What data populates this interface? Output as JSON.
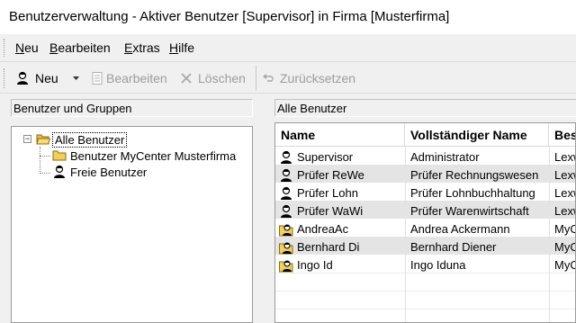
{
  "window": {
    "title": "Benutzerverwaltung - Aktiver Benutzer [Supervisor] in Firma [Musterfirma]"
  },
  "menu": {
    "items": [
      {
        "key": "N",
        "rest": "eu"
      },
      {
        "key": "B",
        "rest": "earbeiten"
      },
      {
        "key": "E",
        "rest": "xtras"
      },
      {
        "key": "H",
        "rest": "ilfe"
      }
    ]
  },
  "toolbar": {
    "new_label": "Neu",
    "edit_label": "Bearbeiten",
    "delete_label": "Löschen",
    "reset_label": "Zurücksetzen",
    "disabled_color": "#9c9c9c"
  },
  "left_panel": {
    "header": "Benutzer und Gruppen",
    "tree": {
      "root": {
        "label": "Alle Benutzer",
        "expander": "−",
        "icon": "folder-open-icon"
      },
      "children": [
        {
          "label": "Benutzer MyCenter Musterfirma",
          "icon": "folder-icon"
        },
        {
          "label": "Freie Benutzer",
          "icon": "user-icon"
        }
      ]
    }
  },
  "right_panel": {
    "header": "Alle Benutzer",
    "columns": [
      "Name",
      "Vollständiger Name",
      "Bes"
    ],
    "rows": [
      {
        "name": "Supervisor",
        "full": "Administrator",
        "desc": "Lexw",
        "icon": "user-dark-icon"
      },
      {
        "name": "Prüfer ReWe",
        "full": "Prüfer Rechnungswesen",
        "desc": "Lexw",
        "icon": "user-dark-icon"
      },
      {
        "name": "Prüfer Lohn",
        "full": "Prüfer Lohnbuchhaltung",
        "desc": "Lexw",
        "icon": "user-dark-icon"
      },
      {
        "name": "Prüfer WaWi",
        "full": "Prüfer Warenwirtschaft",
        "desc": "Lexw",
        "icon": "user-dark-icon"
      },
      {
        "name": "AndreaAc",
        "full": "Andrea Ackermann",
        "desc": "MyC",
        "icon": "user-folder-icon"
      },
      {
        "name": "Bernhard Di",
        "full": "Bernhard Diener",
        "desc": "MyC",
        "icon": "user-folder-icon"
      },
      {
        "name": "Ingo Id",
        "full": "Ingo Iduna",
        "desc": "MyC",
        "icon": "user-folder-icon"
      }
    ]
  },
  "colors": {
    "row_shade": "#e4e4e4",
    "folder": "#f2cf5b"
  }
}
